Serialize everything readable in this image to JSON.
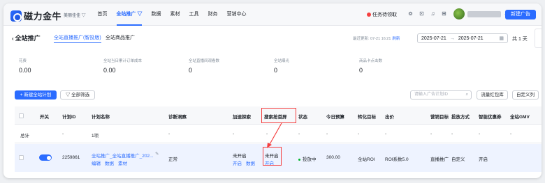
{
  "app": {
    "logo": "磁力金牛",
    "shop_label": "美丽佳佳 ▽"
  },
  "nav": [
    "首页",
    "全站推广 ▽",
    "数据",
    "素材",
    "工具",
    "财务",
    "营销中心"
  ],
  "topbar": {
    "task": "任务待领取",
    "new_ad": "新建广告",
    "icons": [
      "gift-icon",
      "lock-icon",
      "bell-icon",
      "plus-icon"
    ]
  },
  "page": {
    "title": "全站推广",
    "tabs": [
      "全站直播推广(智投版)",
      "全站商品推广"
    ],
    "update_text": "最近更新: 07-21 16:21",
    "refresh": "刷新",
    "date_start": "2025-07-21",
    "date_end": "2025-07-21",
    "days": "共 1 天"
  },
  "metrics": [
    {
      "label": "花费",
      "value": "0.00"
    },
    {
      "label": "全站当日累计订单成本",
      "value": "0.00"
    },
    {
      "label": "全站直播间观看数",
      "value": "0"
    },
    {
      "label": "全站曝光",
      "value": "0"
    },
    {
      "label": "商品卡点击数",
      "value": "0"
    }
  ],
  "toolbar": {
    "new_plan": "+ 新建全站计划",
    "filter": "▽ 全部筛选",
    "search_placeholder": "请输入广告计划ID",
    "red_package": "流量红包库",
    "custom_columns": "自定义列"
  },
  "table": {
    "headers": [
      "开关",
      "计划ID",
      "计划名称",
      "诊断洞察",
      "加速探索",
      "搜索抢首屏",
      "状态",
      "今日预算",
      "转化目标",
      "出价",
      "营销目标",
      "投放方式",
      "智能优惠券",
      "全站GMV"
    ],
    "summary": {
      "label": "总计",
      "dash": "-",
      "count": "1项"
    },
    "row": {
      "plan_id": "2259861",
      "plan_name": "全站推广_全站直播推广_202...",
      "actions": [
        "编辑",
        "数据",
        "素材"
      ],
      "diagnosis": "正常",
      "accel_status": "未开启",
      "accel_actions": [
        "开启",
        "数据"
      ],
      "search_status": "未开启",
      "search_action": "开启",
      "status": "投放中",
      "budget": "300.00",
      "conversion": "全站ROI",
      "bid": "ROI系数5.0",
      "marketing": "直播推广",
      "delivery": "自定义",
      "coupon": "开启"
    }
  }
}
